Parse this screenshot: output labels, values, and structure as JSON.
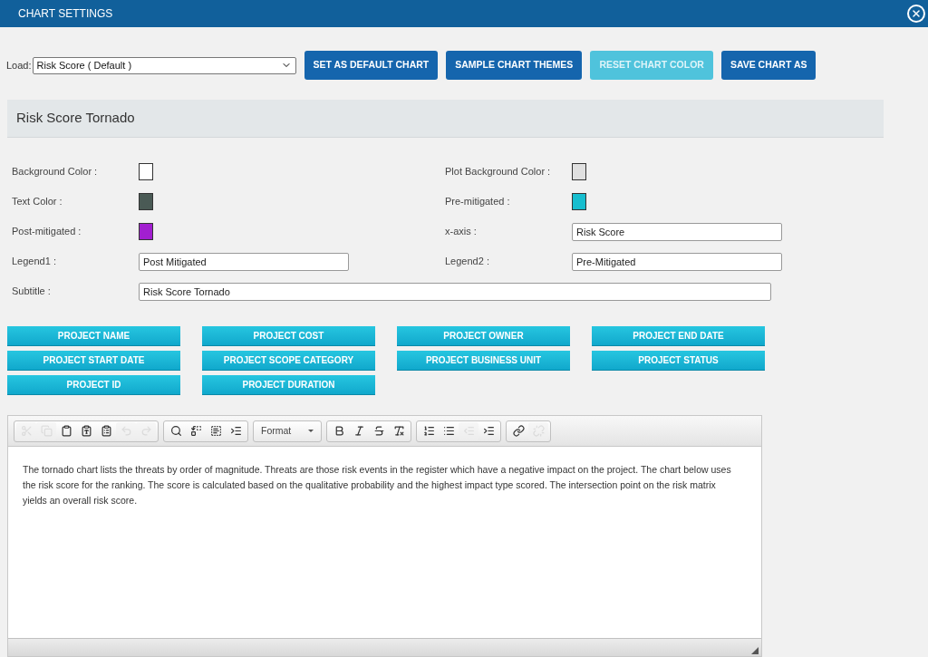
{
  "window": {
    "title": "CHART SETTINGS"
  },
  "load": {
    "label": "Load:",
    "value": "Risk Score ( Default )"
  },
  "actions": [
    {
      "label": "SET AS DEFAULT CHART",
      "disabled": false
    },
    {
      "label": "SAMPLE CHART THEMES",
      "disabled": false
    },
    {
      "label": "RESET CHART COLOR",
      "disabled": true
    },
    {
      "label": "SAVE CHART AS",
      "disabled": false
    }
  ],
  "heading": "Risk Score Tornado",
  "settings": [
    {
      "kind": "color",
      "label": "Background Color :",
      "color": "#ffffff"
    },
    {
      "kind": "color",
      "label": "Plot Background Color :",
      "color": "#e0e0e0"
    },
    {
      "kind": "color",
      "label": "Text Color :",
      "color": "#4a5a55"
    },
    {
      "kind": "color",
      "label": "Pre-mitigated :",
      "color": "#17becf"
    },
    {
      "kind": "color",
      "label": "Post-mitigated :",
      "color": "#a21fd0"
    },
    {
      "kind": "text",
      "label": "x-axis :",
      "value": "Risk Score"
    },
    {
      "kind": "text",
      "label": "Legend1 :",
      "value": "Post Mitigated"
    },
    {
      "kind": "text",
      "label": "Legend2 :",
      "value": "Pre-Mitigated"
    },
    {
      "kind": "wide",
      "label": "Subtitle :",
      "value": "Risk Score Tornado"
    }
  ],
  "field_buttons": [
    "PROJECT NAME",
    "PROJECT COST",
    "PROJECT OWNER",
    "PROJECT END DATE",
    "PROJECT START DATE",
    "PROJECT SCOPE CATEGORY",
    "PROJECT BUSINESS UNIT",
    "PROJECT STATUS",
    "PROJECT ID",
    "PROJECT DURATION"
  ],
  "editor": {
    "toolbar": [
      [
        {
          "kind": "cut",
          "disabled": true
        },
        {
          "kind": "copy",
          "disabled": true
        },
        {
          "kind": "paste",
          "disabled": false
        },
        {
          "kind": "paste-text",
          "disabled": false
        },
        {
          "kind": "paste-word",
          "disabled": false
        },
        {
          "kind": "undo",
          "disabled": true
        },
        {
          "kind": "redo",
          "disabled": true
        }
      ],
      [
        {
          "kind": "find",
          "disabled": false
        },
        {
          "kind": "replace",
          "disabled": false
        },
        {
          "kind": "select-all",
          "disabled": false
        },
        {
          "kind": "indent-block",
          "disabled": false
        }
      ],
      [
        {
          "kind": "format",
          "label": "Format",
          "disabled": false
        }
      ],
      [
        {
          "kind": "bold",
          "disabled": false
        },
        {
          "kind": "italic",
          "disabled": false
        },
        {
          "kind": "strike",
          "disabled": false
        },
        {
          "kind": "clear",
          "disabled": false
        }
      ],
      [
        {
          "kind": "ordered",
          "disabled": false
        },
        {
          "kind": "bullets",
          "disabled": false
        },
        {
          "kind": "outdent",
          "disabled": true
        },
        {
          "kind": "indent",
          "disabled": false
        }
      ],
      [
        {
          "kind": "link",
          "disabled": false
        },
        {
          "kind": "unlink",
          "disabled": true
        }
      ]
    ],
    "content": "The tornado chart lists the threats by order of magnitude. Threats are those risk events in the register which have a negative impact on the project. The chart below uses the risk score for the ranking. The score is calculated based on the qualitative probability and the highest impact type scored. The intersection point on the risk matrix yields an overall risk score."
  }
}
